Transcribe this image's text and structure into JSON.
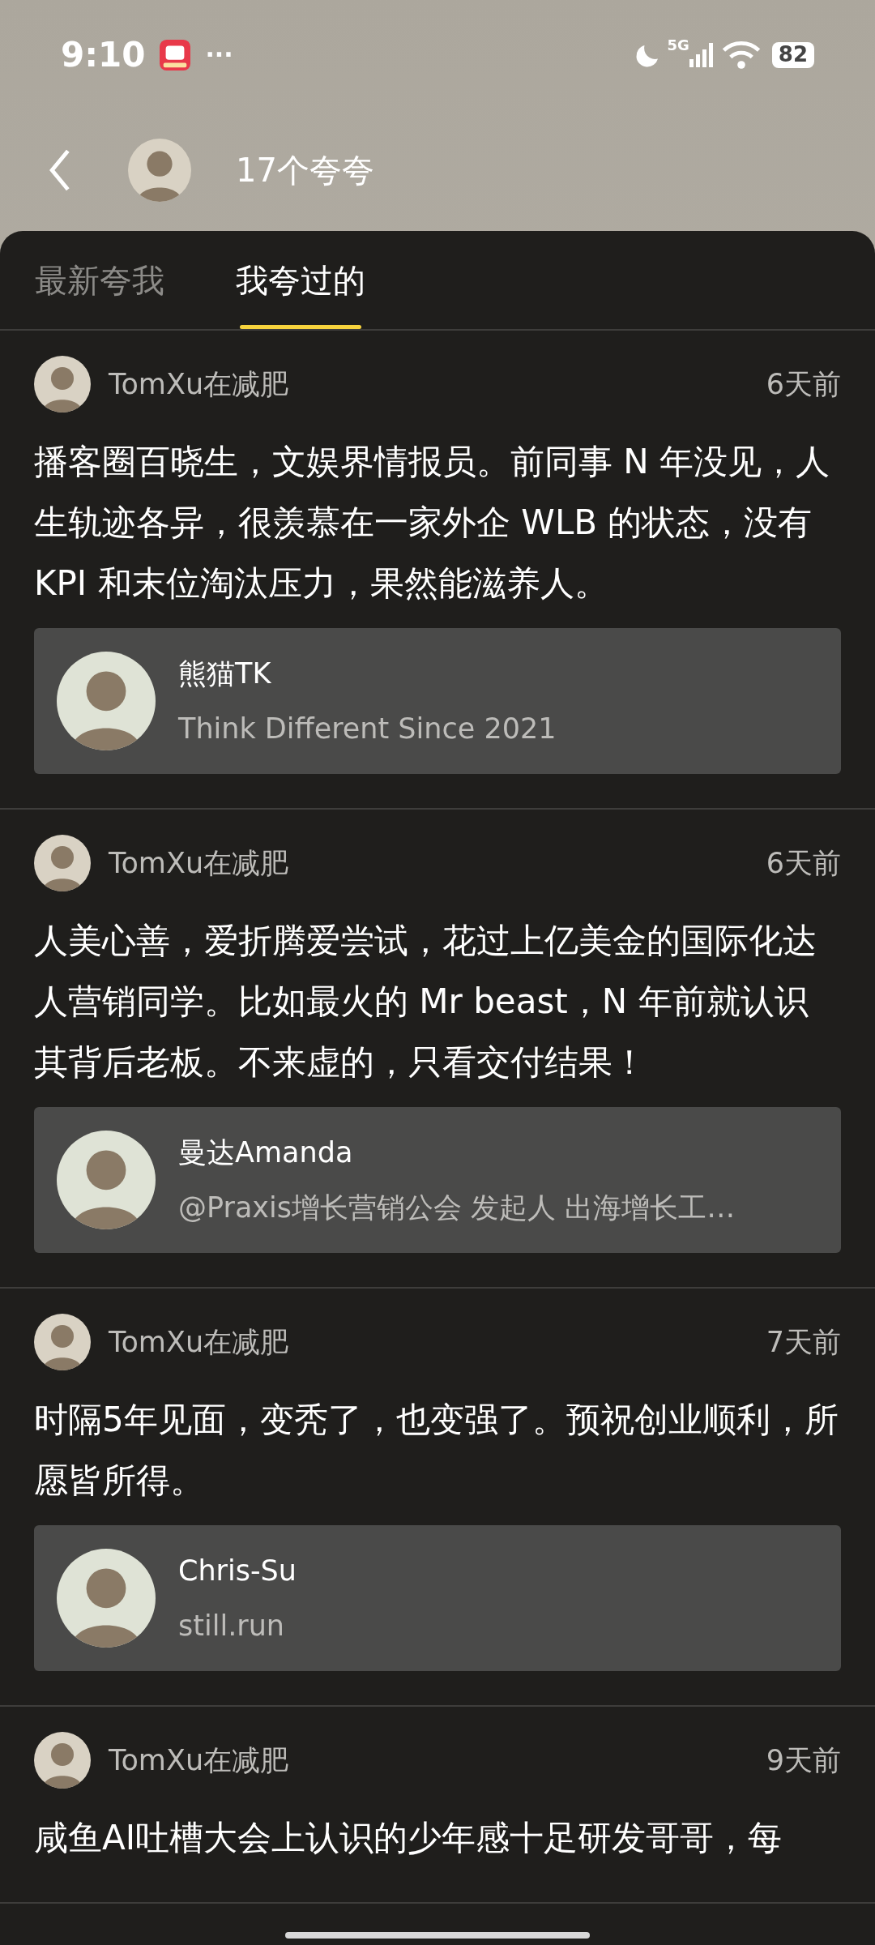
{
  "status_bar": {
    "time": "9:10",
    "more": "···",
    "network": "5G",
    "battery": "82"
  },
  "header": {
    "title": "17个夸夸"
  },
  "tabs": [
    {
      "label": "最新夸我",
      "selected": false
    },
    {
      "label": "我夸过的",
      "selected": true
    }
  ],
  "posts": [
    {
      "author": "TomXu在减肥",
      "time": "6天前",
      "text": "播客圈百晓生，文娱界情报员。前同事 N 年没见，人生轨迹各异，很羡慕在一家外企 WLB 的状态，没有 KPI 和末位淘汰压力，果然能滋养人。",
      "target": {
        "name": "熊猫TK",
        "bio": "Think Different Since 2021"
      }
    },
    {
      "author": "TomXu在减肥",
      "time": "6天前",
      "text": "人美心善，爱折腾爱尝试，花过上亿美金的国际化达人营销同学。比如最火的 Mr beast，N 年前就认识其背后老板。不来虚的，只看交付结果！",
      "target": {
        "name": "曼达Amanda",
        "bio": "@Praxis增长营销公会 发起人 出海增长工…"
      }
    },
    {
      "author": "TomXu在减肥",
      "time": "7天前",
      "text": "时隔5年见面，变秃了，也变强了。预祝创业顺利，所愿皆所得。",
      "target": {
        "name": "Chris-Su",
        "bio": "still.run"
      }
    },
    {
      "author": "TomXu在减肥",
      "time": "9天前",
      "text": "咸鱼AI吐槽大会上认识的少年感十足研发哥哥，每"
    }
  ]
}
